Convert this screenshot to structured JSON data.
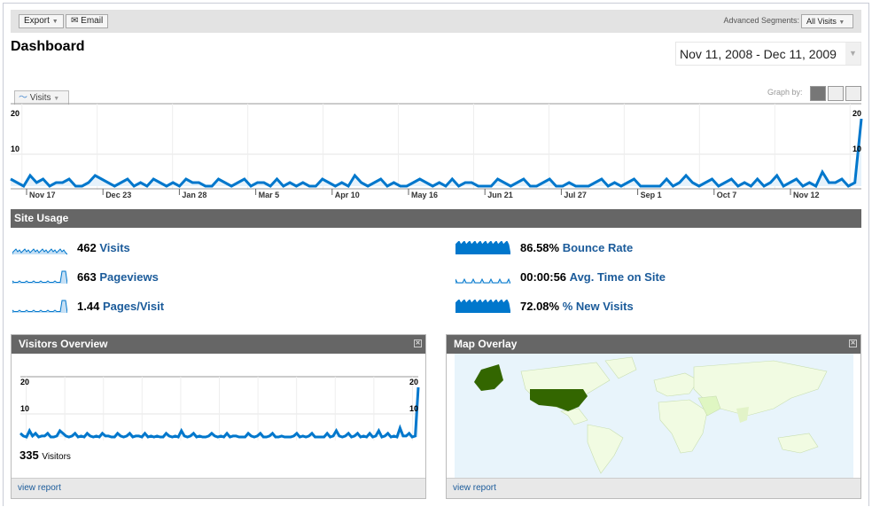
{
  "toolbar": {
    "export_label": "Export",
    "email_label": "Email",
    "segments_label": "Advanced Segments:",
    "segment_value": "All Visits"
  },
  "page": {
    "title": "Dashboard",
    "date_range": "Nov 11, 2008 - Dec 11, 2009"
  },
  "graph": {
    "metric_tab": "Visits",
    "graph_by_label": "Graph by:"
  },
  "chart_data": {
    "type": "line",
    "title": "Visits",
    "ylim": [
      0,
      20
    ],
    "yticks": [
      "10",
      "20"
    ],
    "xticks": [
      "Nov 17",
      "Dec 23",
      "Jan 28",
      "Mar 5",
      "Apr 10",
      "May 16",
      "Jun 21",
      "Jul 27",
      "Sep 1",
      "Oct 7",
      "Nov 12"
    ],
    "values": [
      3,
      2,
      1,
      4,
      2,
      3,
      1,
      2,
      2,
      3,
      1,
      1,
      2,
      4,
      3,
      2,
      1,
      2,
      3,
      1,
      2,
      1,
      3,
      2,
      1,
      2,
      1,
      3,
      2,
      2,
      1,
      1,
      3,
      2,
      1,
      2,
      3,
      1,
      2,
      2,
      1,
      3,
      1,
      2,
      1,
      2,
      1,
      1,
      3,
      2,
      1,
      2,
      1,
      4,
      2,
      1,
      2,
      3,
      1,
      2,
      1,
      1,
      2,
      3,
      2,
      1,
      2,
      1,
      3,
      1,
      2,
      2,
      1,
      1,
      1,
      3,
      2,
      1,
      2,
      3,
      1,
      1,
      2,
      3,
      1,
      1,
      2,
      1,
      1,
      1,
      2,
      3,
      1,
      2,
      1,
      2,
      3,
      1,
      1,
      1,
      1,
      3,
      1,
      2,
      4,
      2,
      1,
      2,
      3,
      1,
      2,
      3,
      1,
      2,
      1,
      3,
      1,
      2,
      4,
      1,
      2,
      3,
      1,
      2,
      1,
      5,
      2,
      2,
      3,
      1,
      2,
      20
    ]
  },
  "site_usage": {
    "title": "Site Usage",
    "left": [
      {
        "value": "462",
        "label": "Visits"
      },
      {
        "value": "663",
        "label": "Pageviews"
      },
      {
        "value": "1.44",
        "label": "Pages/Visit"
      }
    ],
    "right": [
      {
        "value": "86.58%",
        "label": "Bounce Rate"
      },
      {
        "value": "00:00:56",
        "label": "Avg. Time on Site"
      },
      {
        "value": "72.08%",
        "label": "% New Visits"
      }
    ]
  },
  "visitors_overview": {
    "title": "Visitors Overview",
    "count": "335",
    "count_label": "Visitors",
    "y20": "20",
    "y10": "10",
    "link": "view report"
  },
  "map_overlay": {
    "title": "Map Overlay",
    "link": "view report"
  },
  "colors": {
    "line": "#0077cc",
    "bar": "#666666",
    "link": "#1b5b9a",
    "us": "#336600"
  }
}
